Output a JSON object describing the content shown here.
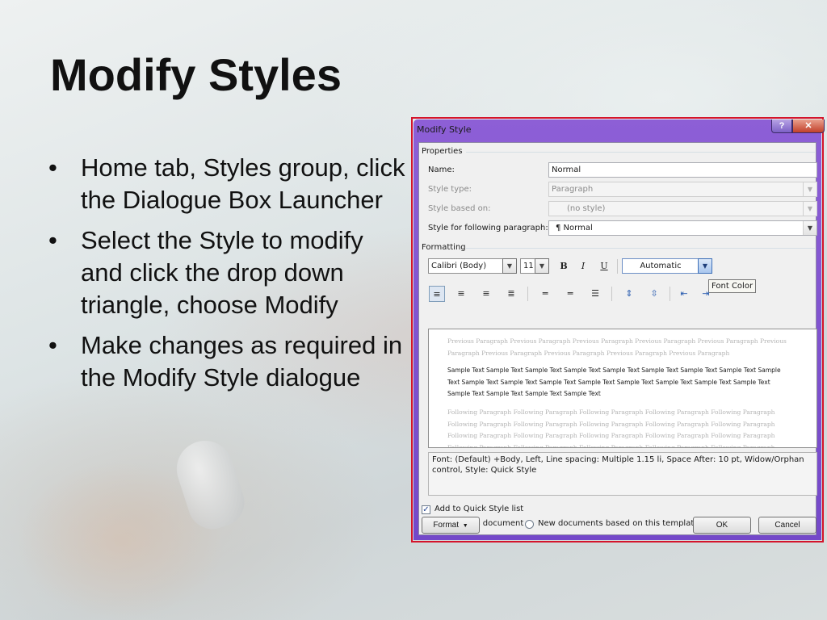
{
  "slide": {
    "title": "Modify Styles",
    "bullets": [
      "Home tab, Styles group, click the Dialogue Box Launcher",
      "Select the Style to modify and click the drop down triangle, choose Modify",
      "Make changes as required in the Modify Style dialogue"
    ]
  },
  "dialog": {
    "title": "Modify Style",
    "help_label": "?",
    "close_label": "✕",
    "properties": {
      "group_label": "Properties",
      "name_label": "Name:",
      "name_value": "Normal",
      "style_type_label": "Style type:",
      "style_type_value": "Paragraph",
      "based_on_label": "Style based on:",
      "based_on_value": "(no style)",
      "following_label": "Style for following paragraph:",
      "following_value": "¶ Normal"
    },
    "formatting": {
      "group_label": "Formatting",
      "font": "Calibri (Body)",
      "size": "11",
      "bold_label": "B",
      "italic_label": "I",
      "underline_label": "U",
      "color_value": "Automatic",
      "tooltip": "Font Color"
    },
    "preview": {
      "previous": "Previous Paragraph Previous Paragraph Previous Paragraph Previous Paragraph Previous Paragraph Previous Paragraph Previous Paragraph Previous Paragraph Previous Paragraph Previous Paragraph",
      "sample": "Sample Text Sample Text Sample Text Sample Text Sample Text Sample Text Sample Text Sample Text Sample Text Sample Text Sample Text Sample Text Sample Text Sample Text Sample Text Sample Text Sample Text Sample Text Sample Text Sample Text Sample Text",
      "following": "Following Paragraph Following Paragraph Following Paragraph Following Paragraph Following Paragraph Following Paragraph Following Paragraph Following Paragraph Following Paragraph Following Paragraph Following Paragraph Following Paragraph Following Paragraph Following Paragraph Following Paragraph Following Paragraph Following Paragraph Following Paragraph Following Paragraph Following Paragraph"
    },
    "description": "Font: (Default) +Body, Left, Line spacing:  Multiple 1.15 li, Space After:  10 pt, Widow/Orphan control, Style: Quick Style",
    "add_quick_style_label": "Add to Quick Style list",
    "only_this_doc_label": "Only in this document",
    "new_docs_label": "New documents based on this template",
    "format_button": "Format",
    "ok_button": "OK",
    "cancel_button": "Cancel"
  }
}
